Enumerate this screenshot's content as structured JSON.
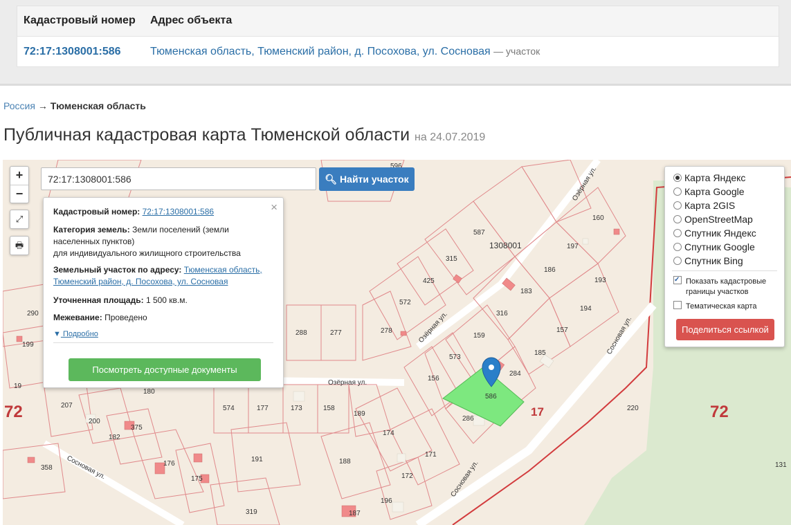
{
  "results": {
    "col_number": "Кадастровый номер",
    "col_address": "Адрес объекта",
    "row_number": "72:17:1308001:586",
    "row_address": "Тюменская область, Тюменский район, д. Посохова, ул. Сосновая",
    "row_type": "— участок"
  },
  "breadcrumb": {
    "root": "Россия",
    "arrow": "→",
    "current": "Тюменская область"
  },
  "page": {
    "title": "Публичная кадастровая карта Тюменской области",
    "date": "на 24.07.2019"
  },
  "search": {
    "value": "72:17:1308001:586",
    "button": "Найти участок"
  },
  "zoom": {
    "plus": "+",
    "minus": "−"
  },
  "popup": {
    "number_label": "Кадастровый номер:",
    "number_value": "72:17:1308001:586",
    "category_label": "Категория земель:",
    "category_value1": "Земли поселений (земли",
    "category_value2": "населенных пунктов)",
    "category_value3": "для индивидуального жилищного строительства",
    "address_label": "Земельный участок по адресу:",
    "address_value1": "Тюменская область,",
    "address_value2": "Тюменский район, д. Посохова, ул. Сосновая",
    "area_label": "Уточненная площадь:",
    "area_value": "1 500 кв.м.",
    "survey_label": "Межевание:",
    "survey_value": "Проведено",
    "more": "Подробно",
    "docs_button": "Посмотреть доступные документы",
    "close": "×"
  },
  "layers": {
    "options": [
      "Карта Яндекс",
      "Карта Google",
      "Карта 2GIS",
      "OpenStreetMap",
      "Спутник Яндекс",
      "Спутник Google",
      "Спутник Bing"
    ],
    "selected": 0,
    "show_borders1": "Показать кадастровые",
    "show_borders2": "границы участков",
    "thematic": "Тематическая карта",
    "share": "Поделиться ссылкой"
  },
  "map_labels": {
    "quarter": "1308001",
    "region_left": "72",
    "region_right": "72",
    "district": "17",
    "street_ozernaya_1": "Озёрная ул.",
    "street_ozernaya_2": "Озёрная ул.",
    "street_ozernaya_3": "Озёрная ул.",
    "street_sosnovaya_1": "Сосновая ул.",
    "street_sosnovaya_2": "Сосновая ул.",
    "street_sosnovaya_3": "Сосновая ул.",
    "parcels": [
      "596",
      "587",
      "160",
      "197",
      "315",
      "425",
      "186",
      "193",
      "183",
      "572",
      "316",
      "194",
      "278",
      "288",
      "277",
      "159",
      "157",
      "573",
      "185",
      "284",
      "156",
      "586",
      "286",
      "220",
      "290",
      "199",
      "207",
      "200",
      "182",
      "375",
      "574",
      "177",
      "173",
      "158",
      "189",
      "180",
      "174",
      "171",
      "188",
      "172",
      "176",
      "175",
      "191",
      "358",
      "196",
      "187",
      "319",
      "131",
      "19"
    ]
  },
  "colors": {
    "parcel_line": "#e0898b",
    "selected_fill": "#7de87f",
    "marker": "#2a7fc9"
  }
}
